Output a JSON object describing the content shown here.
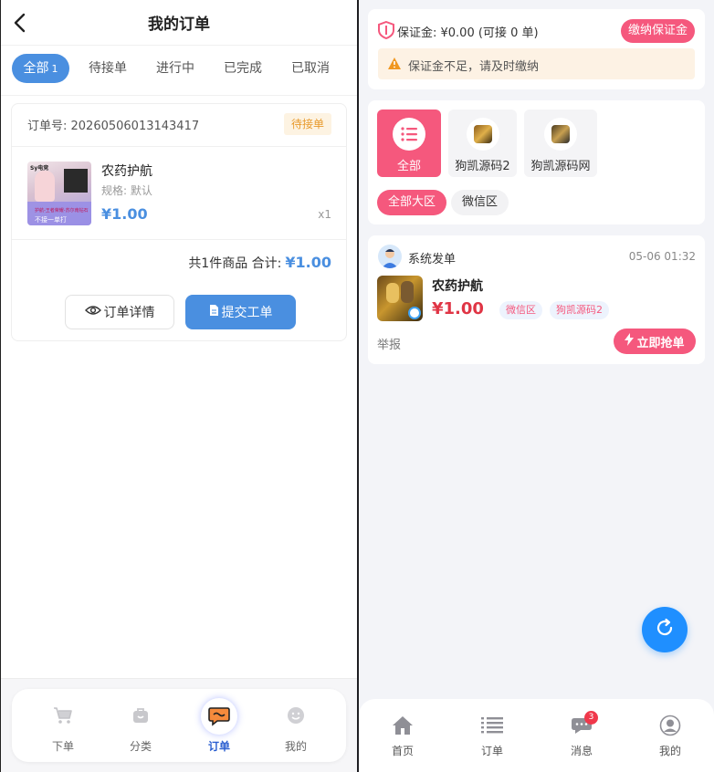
{
  "left": {
    "title": "我的订单",
    "tabs": [
      {
        "label": "全部",
        "count": "1"
      },
      {
        "label": "待接单"
      },
      {
        "label": "进行中"
      },
      {
        "label": "已完成"
      },
      {
        "label": "已取消"
      }
    ],
    "order": {
      "number": "订单号: 20260506013143417",
      "status": "待接单",
      "thumb_text": [
        "Sy电竞",
        "护航-王者荣耀-苏尔南钻石",
        "不接一单打"
      ],
      "product_name": "农药护航",
      "spec": "规格: 默认",
      "price": "¥1.00",
      "qty": "x1",
      "total_label": "共1件商品 合计:",
      "total_amount": "¥1.00",
      "detail_button": "订单详情",
      "submit_button": "提交工单"
    },
    "nav": [
      {
        "label": "下单",
        "icon": "cart-icon"
      },
      {
        "label": "分类",
        "icon": "bag-icon"
      },
      {
        "label": "订单",
        "icon": "chat-bubble-icon",
        "active": true
      },
      {
        "label": "我的",
        "icon": "smile-icon"
      }
    ]
  },
  "right": {
    "deposit": {
      "text": "保证金: ¥0.00 (可接 0 单)",
      "pay_button": "缴纳保证金",
      "warning": "保证金不足，请及时缴纳"
    },
    "categories": [
      {
        "label": "全部",
        "active": true
      },
      {
        "label": "狗凯源码2"
      },
      {
        "label": "狗凯源码网"
      }
    ],
    "regions": [
      {
        "label": "全部大区",
        "active": true
      },
      {
        "label": "微信区"
      }
    ],
    "listing": {
      "sender": "系统发单",
      "time": "05-06 01:32",
      "name": "农药护航",
      "price": "¥1.00",
      "tags": [
        "微信区",
        "狗凯源码2"
      ],
      "report": "举报",
      "grab_button": "立即抢单"
    },
    "nav": [
      {
        "label": "首页",
        "icon": "home-icon"
      },
      {
        "label": "订单",
        "icon": "list-icon"
      },
      {
        "label": "消息",
        "icon": "message-icon",
        "badge": "3"
      },
      {
        "label": "我的",
        "icon": "user-icon"
      }
    ]
  },
  "colors": {
    "primary_blue": "#4a8fe0",
    "pink": "#f5587d",
    "price_red": "#e03545",
    "refresh_blue": "#1f8fff"
  }
}
